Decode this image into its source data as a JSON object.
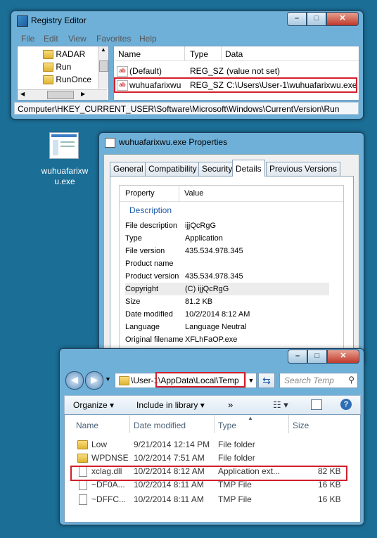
{
  "registry": {
    "title": "Registry Editor",
    "menu": [
      "File",
      "Edit",
      "View",
      "Favorites",
      "Help"
    ],
    "tree": [
      "RADAR",
      "Run",
      "RunOnce"
    ],
    "columns": [
      "Name",
      "Type",
      "Data"
    ],
    "values": [
      {
        "name": "(Default)",
        "type": "REG_SZ",
        "data": "(value not set)"
      },
      {
        "name": "wuhuafarixwu",
        "type": "REG_SZ",
        "data": "C:\\Users\\User-1\\wuhuafarixwu.exe"
      }
    ],
    "status": "Computer\\HKEY_CURRENT_USER\\Software\\Microsoft\\Windows\\CurrentVersion\\Run"
  },
  "desktop_icon": {
    "label_line1": "wuhuafarixw",
    "label_line2": "u.exe"
  },
  "properties": {
    "title": "wuhuafarixwu.exe Properties",
    "tabs": [
      "General",
      "Compatibility",
      "Security",
      "Details",
      "Previous Versions"
    ],
    "active_tab": "Details",
    "header": {
      "property": "Property",
      "value": "Value"
    },
    "section": "Description",
    "rows": [
      {
        "k": "File description",
        "v": "ijjQcRgG"
      },
      {
        "k": "Type",
        "v": "Application"
      },
      {
        "k": "File version",
        "v": "435.534.978.345"
      },
      {
        "k": "Product name",
        "v": ""
      },
      {
        "k": "Product version",
        "v": "435.534.978.345"
      },
      {
        "k": "Copyright",
        "v": "(C) ijjQcRgG"
      },
      {
        "k": "Size",
        "v": "81.2 KB"
      },
      {
        "k": "Date modified",
        "v": "10/2/2014 8:12 AM"
      },
      {
        "k": "Language",
        "v": "Language Neutral"
      },
      {
        "k": "Original filename",
        "v": "XFLhFaOP.exe"
      }
    ]
  },
  "explorer": {
    "path_prefix": "\\User-1",
    "path_highlight": "\\AppData\\Local\\Temp",
    "search_placeholder": "Search Temp",
    "toolbar": {
      "organize": "Organize",
      "include": "Include in library",
      "more": "»"
    },
    "columns": [
      "Name",
      "Date modified",
      "Type",
      "Size"
    ],
    "files": [
      {
        "name": "Low",
        "date": "9/21/2014 12:14 PM",
        "type": "File folder",
        "size": "",
        "kind": "folder"
      },
      {
        "name": "WPDNSE",
        "date": "10/2/2014 7:51 AM",
        "type": "File folder",
        "size": "",
        "kind": "folder"
      },
      {
        "name": "xclag.dll",
        "date": "10/2/2014 8:12 AM",
        "type": "Application ext...",
        "size": "82 KB",
        "kind": "dll"
      },
      {
        "name": "~DF0A...",
        "date": "10/2/2014 8:11 AM",
        "type": "TMP File",
        "size": "16 KB",
        "kind": "tmp"
      },
      {
        "name": "~DFFC...",
        "date": "10/2/2014 8:11 AM",
        "type": "TMP File",
        "size": "16 KB",
        "kind": "tmp"
      }
    ]
  }
}
